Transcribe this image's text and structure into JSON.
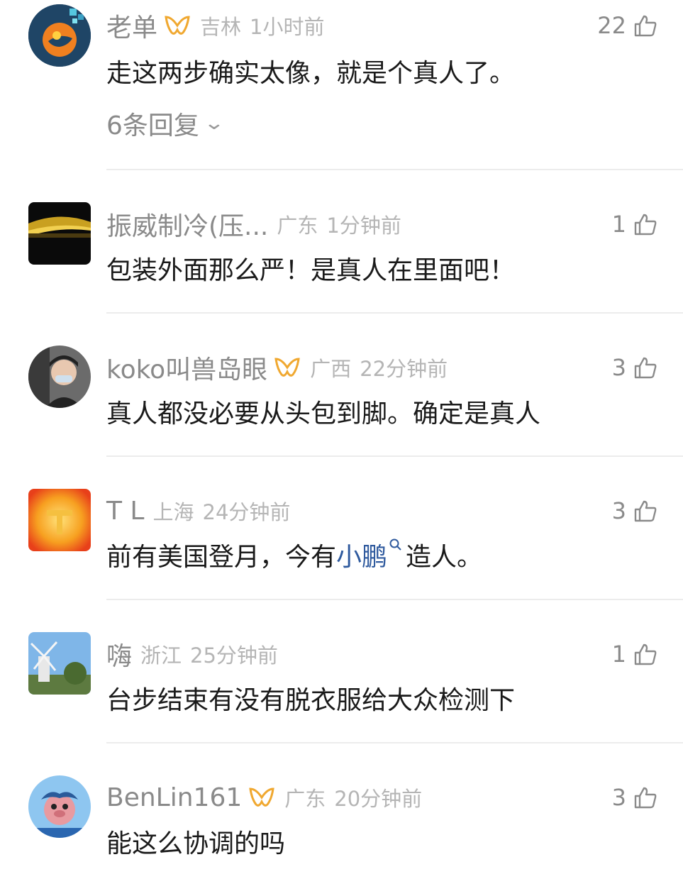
{
  "comments": [
    {
      "name": "老单",
      "location": "吉林",
      "time": "1小时前",
      "likes": "22",
      "text": "走这两步确实太像，就是个真人了。",
      "replies": "6条回复"
    },
    {
      "name": "振威制冷(压...",
      "location": "广东",
      "time": "1分钟前",
      "likes": "1",
      "text": "包装外面那么严！是真人在里面吧！"
    },
    {
      "name": "koko叫兽岛眼",
      "location": "广西",
      "time": "22分钟前",
      "likes": "3",
      "text": "真人都没必要从头包到脚。确定是真人"
    },
    {
      "name": "T L",
      "location": "上海",
      "time": "24分钟前",
      "likes": "3",
      "text_before": "前有美国登月，今有",
      "text_link": "小鹏",
      "text_after": "造人。"
    },
    {
      "name": "嗨",
      "location": "浙江",
      "time": "25分钟前",
      "likes": "1",
      "text": "台步结束有没有脱衣服给大众检测下"
    },
    {
      "name": "BenLin161",
      "location": "广东",
      "time": "20分钟前",
      "likes": "3",
      "text": "能这么协调的吗"
    }
  ],
  "colors": {
    "name": "#8a8a8a",
    "meta": "#b5b5b5",
    "text": "#1a1a1a",
    "link": "#2f5a9e",
    "badge": "#f0a830",
    "divider": "#ececec"
  }
}
